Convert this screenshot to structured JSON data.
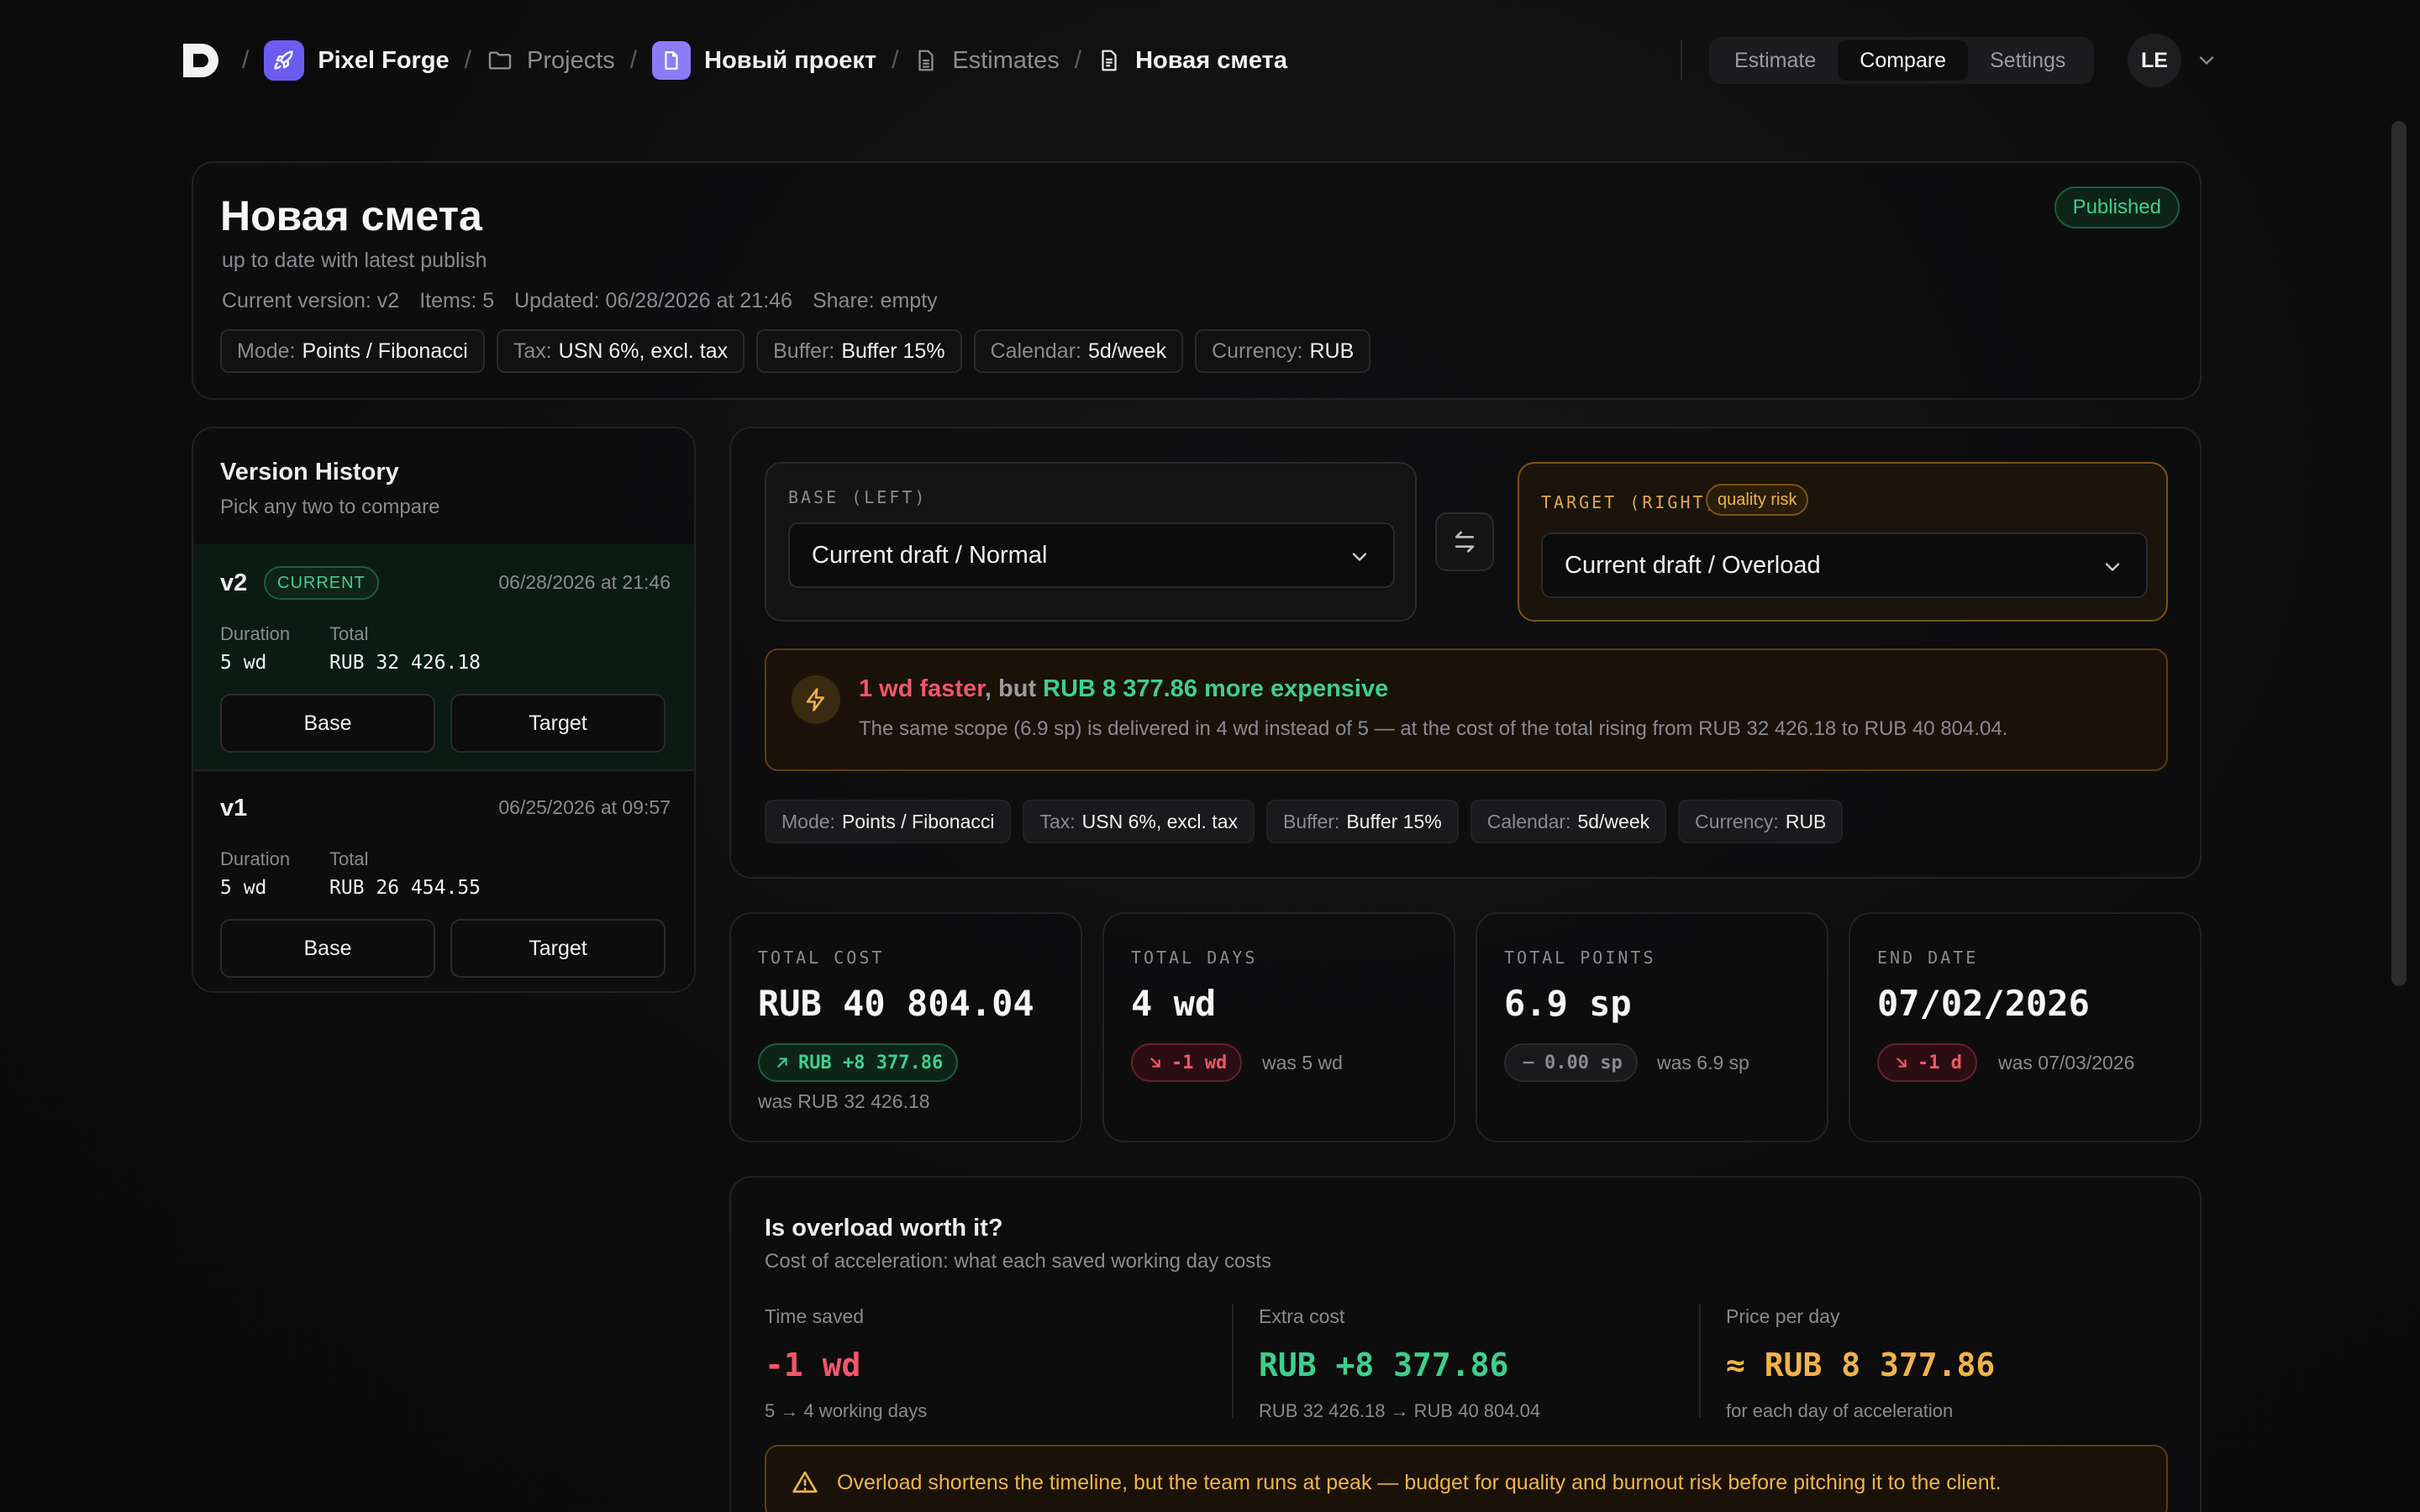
{
  "breadcrumb": {
    "workspace": "Pixel Forge",
    "projects": "Projects",
    "project": "Новый проект",
    "estimates": "Estimates",
    "current": "Новая смета"
  },
  "nav_tabs": [
    {
      "label": "Estimate",
      "active": false
    },
    {
      "label": "Compare",
      "active": true
    },
    {
      "label": "Settings",
      "active": false
    }
  ],
  "user": {
    "initials": "LE"
  },
  "header": {
    "title": "Новая смета",
    "subtitle": "up to date with latest publish",
    "status": "Published",
    "meta": {
      "version": "Current version: v2",
      "items": "Items: 5",
      "updated": "Updated: 06/28/2026 at 21:46",
      "share": "Share: empty"
    },
    "chips": [
      {
        "label": "Mode:",
        "value": "Points / Fibonacci"
      },
      {
        "label": "Tax:",
        "value": "USN 6%, excl. tax"
      },
      {
        "label": "Buffer:",
        "value": "Buffer 15%"
      },
      {
        "label": "Calendar:",
        "value": "5d/week"
      },
      {
        "label": "Currency:",
        "value": "RUB"
      }
    ]
  },
  "version_history": {
    "title": "Version History",
    "subtitle": "Pick any two to compare",
    "duration_label": "Duration",
    "total_label": "Total",
    "base_label": "Base",
    "target_label": "Target",
    "versions": [
      {
        "name": "v2",
        "badge": "CURRENT",
        "date": "06/28/2026 at 21:46",
        "duration": "5 wd",
        "total": "RUB 32 426.18"
      },
      {
        "name": "v1",
        "date": "06/25/2026 at 09:57",
        "duration": "5 wd",
        "total": "RUB 26 454.55"
      }
    ]
  },
  "compare": {
    "base": {
      "label": "BASE (LEFT)",
      "value": "Current draft / Normal"
    },
    "target": {
      "label": "TARGET (RIGHT)",
      "badge": "quality risk",
      "value": "Current draft / Overload"
    },
    "insight": {
      "faster": "1 wd faster",
      "but": ", but ",
      "expensive": "RUB 8 377.86 more expensive",
      "description": "The same scope (6.9 sp) is delivered in 4 wd instead of 5 — at the cost of the total rising from RUB 32 426.18 to RUB 40 804.04."
    },
    "chips": [
      {
        "label": "Mode:",
        "value": "Points / Fibonacci"
      },
      {
        "label": "Tax:",
        "value": "USN 6%, excl. tax"
      },
      {
        "label": "Buffer:",
        "value": "Buffer 15%"
      },
      {
        "label": "Calendar:",
        "value": "5d/week"
      },
      {
        "label": "Currency:",
        "value": "RUB"
      }
    ]
  },
  "stats": [
    {
      "label": "TOTAL COST",
      "value": "RUB 40 804.04",
      "delta": "RUB +8 377.86",
      "trend": "up",
      "was": "was RUB 32 426.18"
    },
    {
      "label": "TOTAL DAYS",
      "value": "4 wd",
      "delta": "-1 wd",
      "trend": "down",
      "was": "was 5 wd"
    },
    {
      "label": "TOTAL POINTS",
      "value": "6.9 sp",
      "delta": "0.00 sp",
      "trend": "flat",
      "was": "was 6.9 sp"
    },
    {
      "label": "END DATE",
      "value": "07/02/2026",
      "delta": "-1 d",
      "trend": "down",
      "was": "was 07/03/2026"
    }
  ],
  "worth": {
    "title": "Is overload worth it?",
    "subtitle": "Cost of acceleration: what each saved working day costs",
    "columns": [
      {
        "label": "Time saved",
        "value": "-1 wd",
        "note": "5 → 4 working days",
        "color": "#f0576a"
      },
      {
        "label": "Extra cost",
        "value": "RUB +8 377.86",
        "note": "RUB 32 426.18 → RUB 40 804.04",
        "color": "#3ecf8e"
      },
      {
        "label": "Price per day",
        "value": "≈ RUB 8 377.86",
        "note": "for each day of acceleration",
        "color": "#f0b34a"
      }
    ],
    "warning": "Overload shortens the timeline, but the team runs at peak — budget for quality and burnout risk before pitching it to the client."
  },
  "colors": {
    "accent": "#6a5cf0",
    "positive": "#3ecf8e",
    "negative": "#f0576a",
    "warning": "#f0b34a"
  }
}
